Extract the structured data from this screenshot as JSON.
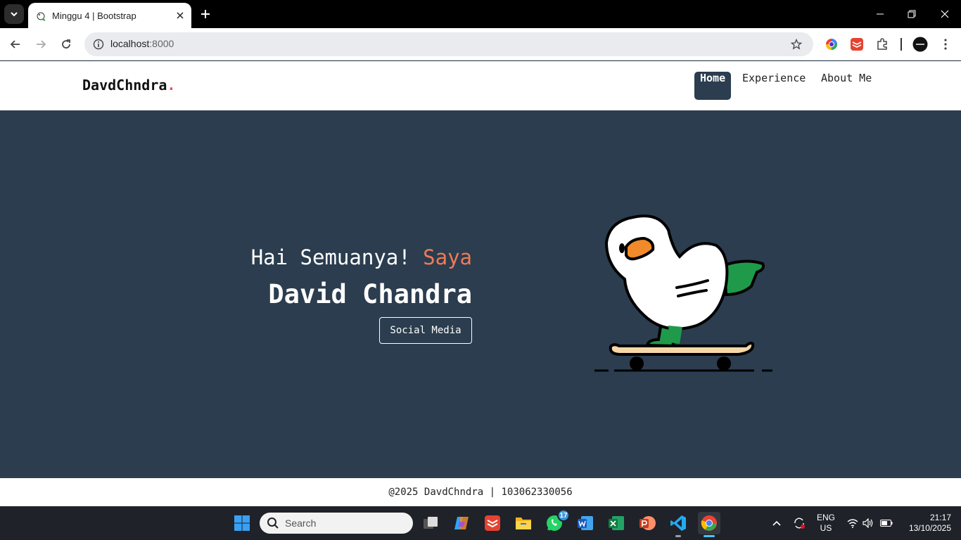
{
  "browser": {
    "tab_title": "Minggu 4 | Bootstrap",
    "url_host": "localhost",
    "url_port": ":8000",
    "icons": [
      "tab-search-icon",
      "favicon-icon",
      "close-icon",
      "plus-icon",
      "minimize-icon",
      "restore-icon",
      "window-close-icon",
      "back-icon",
      "forward-icon",
      "reload-icon",
      "site-info-icon",
      "star-icon",
      "extensions-icon",
      "profile-avatar",
      "kebab-menu-icon"
    ]
  },
  "site": {
    "brand": "DavdChndra",
    "brand_dot": ".",
    "nav": [
      {
        "label": "Home",
        "active": true
      },
      {
        "label": "Experience",
        "active": false
      },
      {
        "label": "About Me",
        "active": false
      }
    ],
    "hero": {
      "greeting": "Hai Semuanya! ",
      "greeting_accent": "Saya",
      "name": "David Chandra",
      "button": "Social Media"
    },
    "footer": "@2025 DavdChndra | 103062330056",
    "colors": {
      "primary": "#2b3d4f",
      "accent": "#f07a55",
      "brand_dot": "#e84b5a"
    }
  },
  "taskbar": {
    "search_placeholder": "Search",
    "whatsapp_badge": "17",
    "lang_line1": "ENG",
    "lang_line2": "US",
    "time": "21:17",
    "date": "13/10/2025"
  }
}
